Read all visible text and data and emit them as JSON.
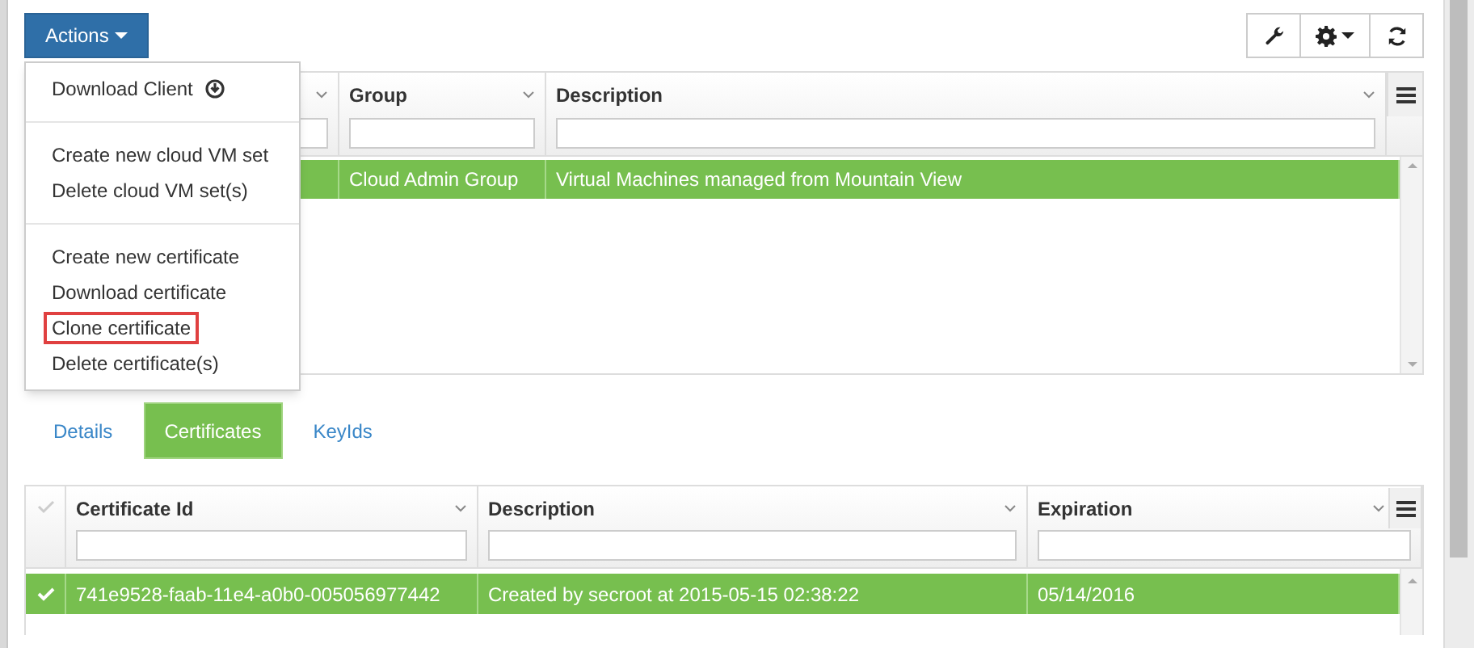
{
  "actions_button": {
    "label": "Actions"
  },
  "actions_menu": {
    "groups": [
      [
        {
          "label": "Download Client",
          "kind": "download",
          "highlighted": false
        }
      ],
      [
        {
          "label": "Create new cloud VM set",
          "kind": "plain",
          "highlighted": false
        },
        {
          "label": "Delete cloud VM set(s)",
          "kind": "plain",
          "highlighted": false
        }
      ],
      [
        {
          "label": "Create new certificate",
          "kind": "plain",
          "highlighted": false
        },
        {
          "label": "Download certificate",
          "kind": "plain",
          "highlighted": false
        },
        {
          "label": "Clone certificate",
          "kind": "plain",
          "highlighted": true
        },
        {
          "label": "Delete certificate(s)",
          "kind": "plain",
          "highlighted": false
        }
      ]
    ]
  },
  "toolbar": [
    {
      "kind": "wrench"
    },
    {
      "kind": "gear"
    },
    {
      "kind": "refresh"
    }
  ],
  "vm_sets_table": {
    "columns": [
      {
        "kind": "covered"
      },
      {
        "kind": "text",
        "label": "Group"
      },
      {
        "kind": "text",
        "label": "Description"
      }
    ],
    "rows": [
      {
        "selected": true,
        "cells": [
          "",
          "Cloud Admin Group",
          "Virtual Machines managed from Mountain View"
        ]
      }
    ]
  },
  "tabs": [
    {
      "label": "Details",
      "selected": false
    },
    {
      "label": "Certificates",
      "selected": true
    },
    {
      "label": "KeyIds",
      "selected": false
    }
  ],
  "certificates_table": {
    "columns": [
      {
        "label": "Certificate Id"
      },
      {
        "label": "Description"
      },
      {
        "label": "Expiration"
      }
    ],
    "rows": [
      {
        "selected": true,
        "cells": [
          "741e9528-faab-11e4-a0b0-005056977442",
          "Created by secroot at 2015-05-15 02:38:22",
          "05/14/2016"
        ]
      }
    ]
  }
}
